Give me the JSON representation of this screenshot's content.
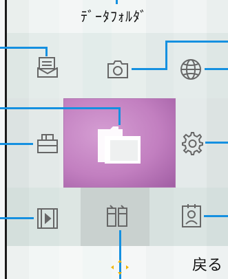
{
  "header": {
    "title": "ﾃﾞｰﾀﾌｫﾙﾀﾞ"
  },
  "softkeys": {
    "back_label": "戻る"
  },
  "grid": {
    "row1": [
      "mail-icon",
      "camera-icon",
      "globe-icon"
    ],
    "row2": [
      "tool-box-icon",
      "folder-icon",
      "settings-icon"
    ],
    "row3": [
      "video-icon",
      "tools-icon",
      "contact-icon"
    ]
  },
  "colors": {
    "accent_line": "#1590e0",
    "highlight_tile": "#c27fc0",
    "nav_cross": "#f0b400"
  }
}
